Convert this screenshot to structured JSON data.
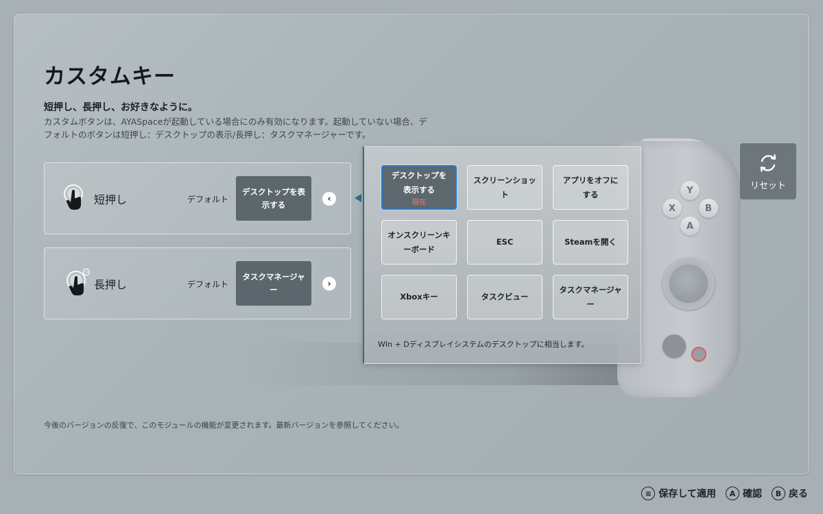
{
  "page": {
    "title": "カスタムキー",
    "subtitle": "短押し、長押し、お好きなように。",
    "description_line1": "カスタムボタンは、AYASpaceが起動している場合にのみ有効になります。起動していない場合、デ",
    "description_line2": "フォルトのボタンは短押し：デスクトップの表示/長押し：タスクマネージャーです。",
    "footnote": "今後のバージョンの反復で、このモジュールの機能が変更されます。最新バージョンを参照してください。"
  },
  "modes": [
    {
      "label": "短押し",
      "default_label": "デフォルト",
      "value": "デスクトップを表示する",
      "arrow": "‹",
      "icon": "tap-hand-icon"
    },
    {
      "label": "長押し",
      "default_label": "デフォルト",
      "value": "タスクマネージャー",
      "arrow": "›",
      "icon": "long-press-hand-icon"
    }
  ],
  "options_panel": {
    "options": [
      {
        "label": "デスクトップを表示する",
        "status": "現在",
        "selected": true
      },
      {
        "label": "スクリーンショット",
        "selected": false
      },
      {
        "label": "アプリをオフにする",
        "selected": false
      },
      {
        "label": "オンスクリーンキーボード",
        "selected": false
      },
      {
        "label": "ESC",
        "selected": false
      },
      {
        "label": "Steamを開く",
        "selected": false
      },
      {
        "label": "Xboxキー",
        "selected": false
      },
      {
        "label": "タスクビュー",
        "selected": false
      },
      {
        "label": "タスクマネージャー",
        "selected": false
      }
    ],
    "description": "WIn + Dディスプレイシステムのデスクトップに相当します。"
  },
  "controller": {
    "buttons": {
      "y": "Y",
      "x": "X",
      "b": "B",
      "a": "A"
    }
  },
  "reset": {
    "label": "リセット",
    "icon": "refresh-icon"
  },
  "hints": [
    {
      "glyph": "≡",
      "label": "保存して適用",
      "icon": "menu-icon"
    },
    {
      "glyph": "A",
      "label": "確認",
      "icon": "a-button-icon"
    },
    {
      "glyph": "B",
      "label": "戻る",
      "icon": "b-button-icon"
    }
  ],
  "colors": {
    "background": "#a6b0b5",
    "selected_fill": "#5d676e",
    "selected_border": "#1f7ad6",
    "accent_pointer": "#2f6d86",
    "current_text": "#f07a6a"
  }
}
